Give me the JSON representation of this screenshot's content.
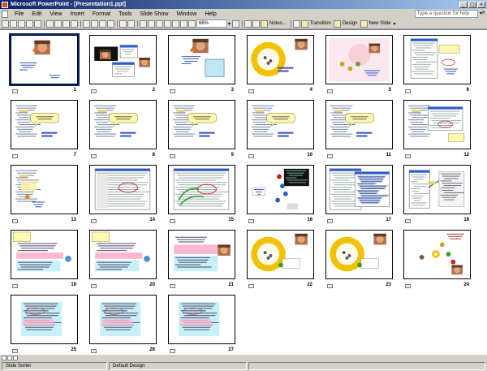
{
  "title": "Microsoft PowerPoint - [Presentation1.ppt]",
  "window_controls": [
    "_",
    "□",
    "×"
  ],
  "menu": [
    "File",
    "Edit",
    "View",
    "Insert",
    "Format",
    "Tools",
    "Slide Show",
    "Window",
    "Help"
  ],
  "help_placeholder": "Type a question for help",
  "toolbar": {
    "zoom": "66%",
    "notes_label": "Notes...",
    "transition_label": "Transition",
    "design_label": "Design",
    "new_slide_label": "New Slide"
  },
  "slides": [
    {
      "number": "1",
      "kind": "photo-title",
      "selected": true
    },
    {
      "number": "2",
      "kind": "screenshots"
    },
    {
      "number": "3",
      "kind": "photo-box"
    },
    {
      "number": "4",
      "kind": "donut"
    },
    {
      "number": "5",
      "kind": "scene"
    },
    {
      "number": "6",
      "kind": "tree"
    },
    {
      "number": "7",
      "kind": "tree-callout"
    },
    {
      "number": "8",
      "kind": "tree-callout"
    },
    {
      "number": "9",
      "kind": "tree-callout"
    },
    {
      "number": "10",
      "kind": "tree-callout"
    },
    {
      "number": "11",
      "kind": "tree-callout"
    },
    {
      "number": "12",
      "kind": "tree-window"
    },
    {
      "number": "13",
      "kind": "tree-highlight"
    },
    {
      "number": "14",
      "kind": "window-circle"
    },
    {
      "number": "15",
      "kind": "window-circle-green"
    },
    {
      "number": "16",
      "kind": "network"
    },
    {
      "number": "17",
      "kind": "file-list"
    },
    {
      "number": "18",
      "kind": "tree-arrow"
    },
    {
      "number": "19",
      "kind": "text-pink"
    },
    {
      "number": "20",
      "kind": "text-pink"
    },
    {
      "number": "21",
      "kind": "text-photo"
    },
    {
      "number": "22",
      "kind": "donut-photo"
    },
    {
      "number": "23",
      "kind": "donut-photo"
    },
    {
      "number": "24",
      "kind": "icons"
    },
    {
      "number": "25",
      "kind": "text-cyan"
    },
    {
      "number": "26",
      "kind": "text-cyan"
    },
    {
      "number": "27",
      "kind": "text-cyan"
    }
  ],
  "status": {
    "view": "Slide Sorter",
    "design": "Default Design"
  }
}
